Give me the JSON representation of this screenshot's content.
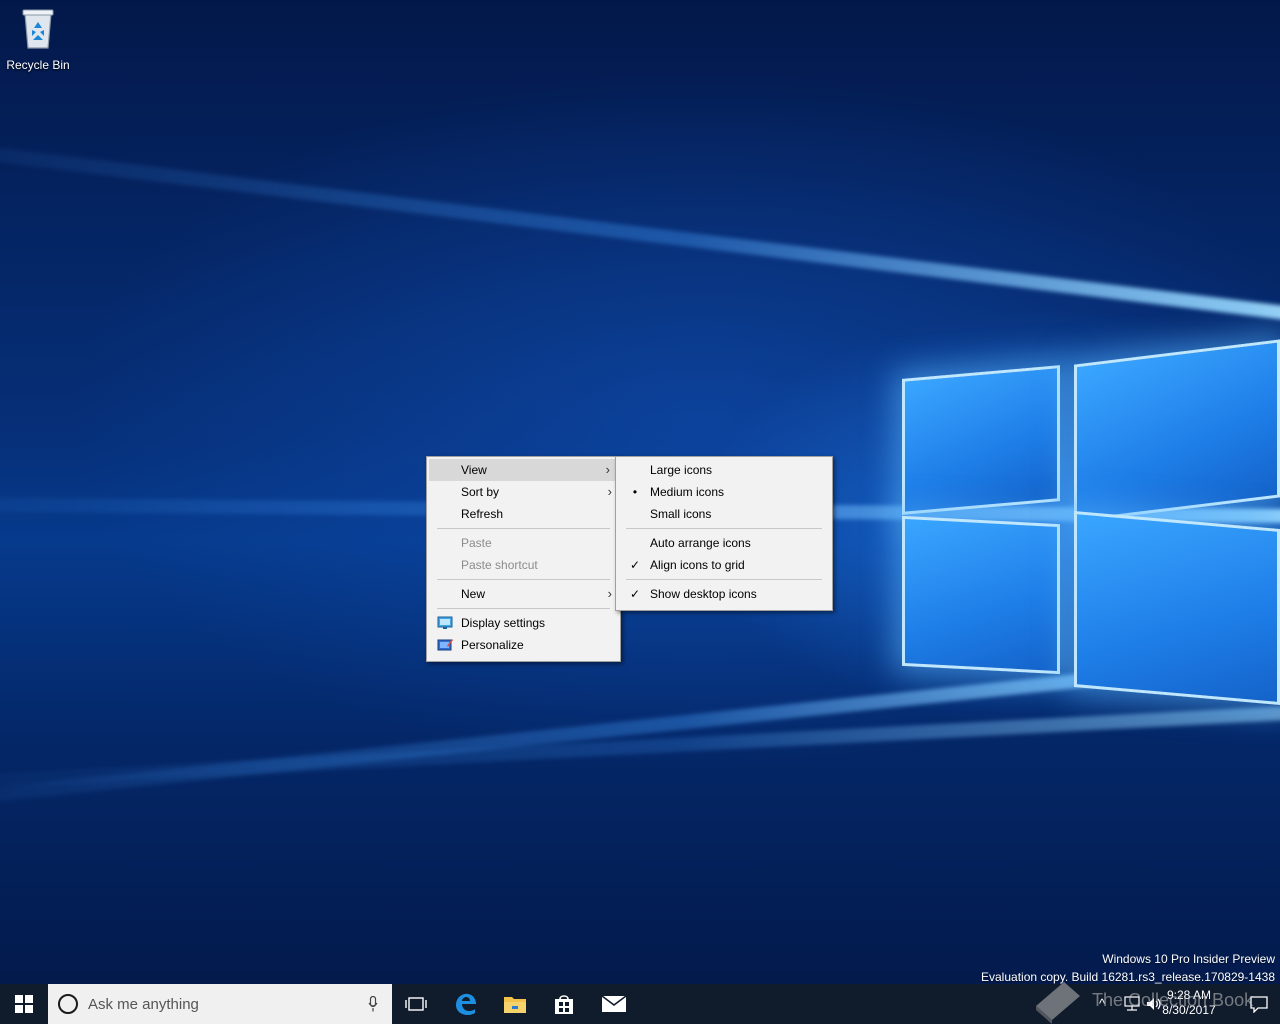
{
  "desktop": {
    "icons": [
      {
        "label": "Recycle Bin",
        "icon": "recycle-bin-icon"
      }
    ]
  },
  "context_menu": {
    "items": [
      {
        "label": "View",
        "submenu": true,
        "highlighted": true
      },
      {
        "label": "Sort by",
        "submenu": true
      },
      {
        "label": "Refresh"
      },
      {
        "label": "Paste",
        "disabled": true
      },
      {
        "label": "Paste shortcut",
        "disabled": true
      },
      {
        "label": "New",
        "submenu": true
      },
      {
        "label": "Display settings",
        "icon": "display-settings-icon"
      },
      {
        "label": "Personalize",
        "icon": "personalize-icon"
      }
    ],
    "submenu_arrow": "›"
  },
  "view_submenu": {
    "items": [
      {
        "label": "Large icons",
        "mark": ""
      },
      {
        "label": "Medium icons",
        "mark": "•"
      },
      {
        "label": "Small icons",
        "mark": ""
      },
      {
        "label": "Auto arrange icons",
        "mark": ""
      },
      {
        "label": "Align icons to grid",
        "mark": "✓"
      },
      {
        "label": "Show desktop icons",
        "mark": "✓"
      }
    ]
  },
  "watermark": {
    "line1": "Windows 10 Pro Insider Preview",
    "line2": "Evaluation copy. Build 16281.rs3_release.170829-1438"
  },
  "taskbar": {
    "start_icon": "windows-logo-icon",
    "search_placeholder": "Ask me anything",
    "pinned": [
      "task-view-icon",
      "edge-icon",
      "file-explorer-icon",
      "store-icon",
      "mail-icon"
    ],
    "clock_time": "9:28 AM",
    "clock_date": "8/30/2017",
    "tray_icons": [
      "show-hidden-icons-icon",
      "network-icon",
      "volume-icon",
      "action-center-icon"
    ]
  },
  "branding": {
    "text": "The Collection Book"
  },
  "colors": {
    "menu_bg": "#f2f2f2",
    "menu_highlight": "#d8d8d8",
    "taskbar_bg": "#101b2c",
    "search_bg": "#f0f0f0"
  }
}
